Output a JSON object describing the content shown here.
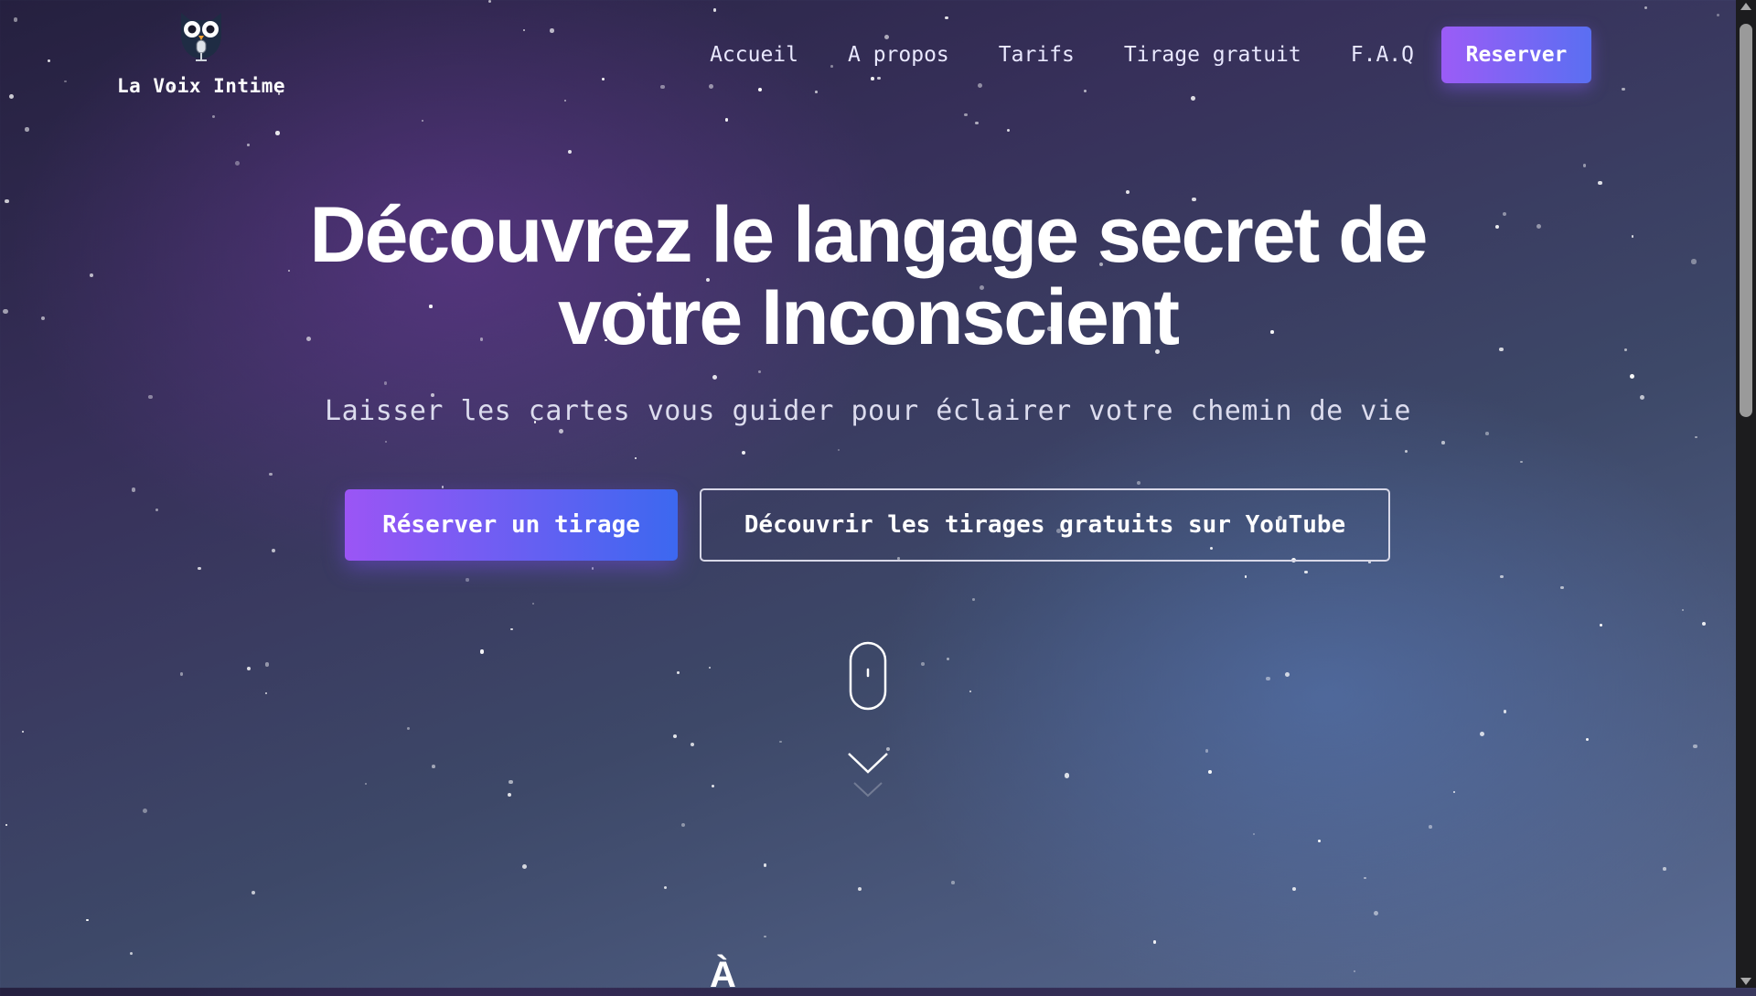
{
  "brand": {
    "name": "La Voix Intime",
    "logo_icon": "owl-microphone-icon"
  },
  "nav": {
    "links": [
      "Accueil",
      "A propos",
      "Tarifs",
      "Tirage gratuit",
      "F.A.Q"
    ],
    "cta_label": "Reserver"
  },
  "hero": {
    "title_line1": "Découvrez le langage secret de",
    "title_line2": "votre Inconscient",
    "subtitle": "Laisser les cartes vous guider pour éclairer votre chemin de vie",
    "primary_button": "Réserver un tirage",
    "secondary_button": "Découvrir les tirages gratuits sur YouTube"
  },
  "scroll_hint": {
    "mouse_icon": "mouse-scroll-icon",
    "arrow_icon": "chevron-down-icon"
  },
  "next_section_peek": "À",
  "colors": {
    "accent_purple": "#9b55f5",
    "accent_blue": "#3c68f0",
    "background_top": "#25203f",
    "background_bottom": "#5a6c94"
  }
}
